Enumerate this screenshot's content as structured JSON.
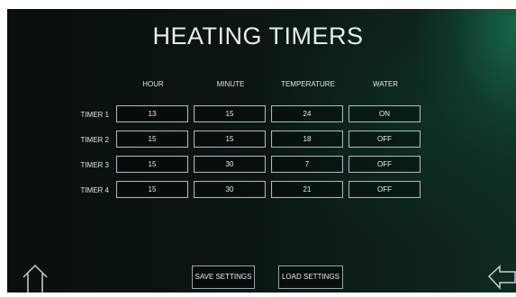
{
  "title": "HEATING TIMERS",
  "columns": [
    "HOUR",
    "MINUTE",
    "TEMPERATURE",
    "WATER"
  ],
  "timers": [
    {
      "label": "TIMER 1",
      "hour": "13",
      "minute": "15",
      "temperature": "24",
      "water": "ON"
    },
    {
      "label": "TIMER 2",
      "hour": "15",
      "minute": "15",
      "temperature": "18",
      "water": "OFF"
    },
    {
      "label": "TIMER 3",
      "hour": "15",
      "minute": "30",
      "temperature": "7",
      "water": "OFF"
    },
    {
      "label": "TIMER 4",
      "hour": "15",
      "minute": "30",
      "temperature": "21",
      "water": "OFF"
    }
  ],
  "buttons": {
    "save": "SAVE SETTINGS",
    "load": "LOAD SETTINGS"
  },
  "icons": {
    "home": "home-icon",
    "back": "back-arrow-icon"
  },
  "colors": {
    "text": "#e6eef0",
    "border": "#aab6bc",
    "background": "#0b1511",
    "accent_glow": "#1e9664"
  }
}
